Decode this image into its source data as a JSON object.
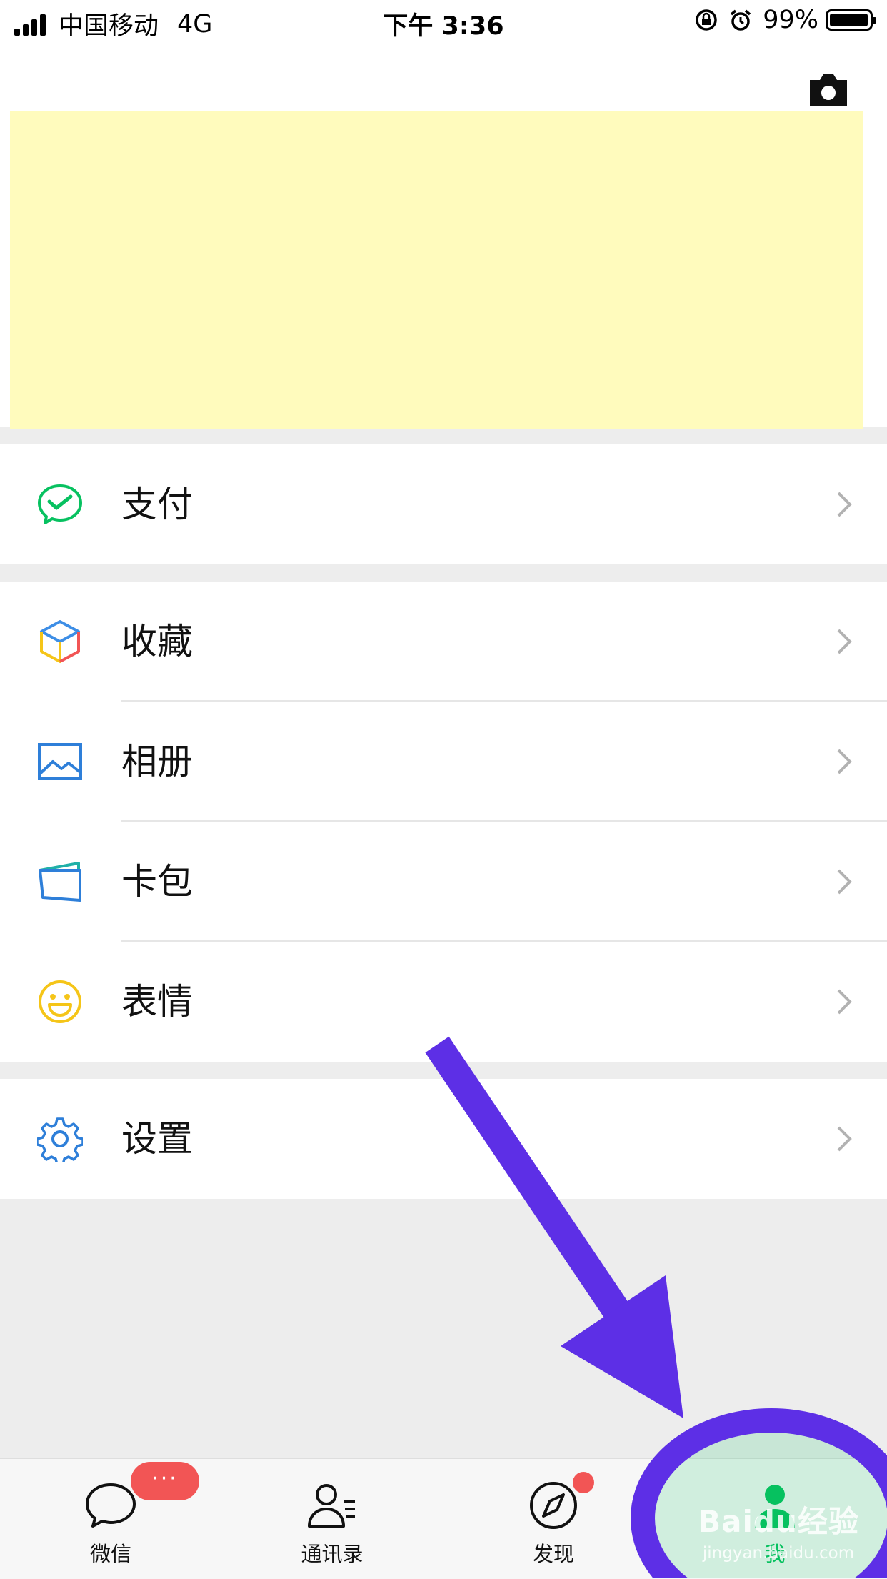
{
  "status_bar": {
    "carrier": "中国移动",
    "network": "4G",
    "time": "下午 3:36",
    "battery": "99%"
  },
  "menu": {
    "group1": [
      {
        "label": "支付",
        "icon": "pay-icon"
      }
    ],
    "group2": [
      {
        "label": "收藏",
        "icon": "favorites-cube-icon"
      },
      {
        "label": "相册",
        "icon": "album-image-icon"
      },
      {
        "label": "卡包",
        "icon": "card-wallet-icon"
      },
      {
        "label": "表情",
        "icon": "smiley-icon"
      }
    ],
    "group3": [
      {
        "label": "设置",
        "icon": "gear-icon"
      }
    ]
  },
  "tabbar": {
    "tabs": [
      {
        "label": "微信",
        "icon": "chat-bubble-icon"
      },
      {
        "label": "通讯录",
        "icon": "contacts-icon"
      },
      {
        "label": "发现",
        "icon": "compass-icon"
      },
      {
        "label": "我",
        "icon": "person-icon"
      }
    ],
    "chat_badge": "···",
    "active_tab": "我"
  },
  "watermark": {
    "main": "Baidu经验",
    "sub": "jingyan.baidu.com"
  },
  "colors": {
    "accent_green": "#07c160",
    "badge_red": "#f25555",
    "annotation_purple": "#5d2fe6",
    "profile_mask": "#fffbbd"
  }
}
